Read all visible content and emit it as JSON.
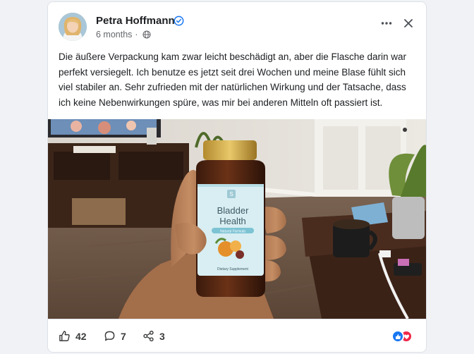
{
  "post": {
    "author": "Petra Hoffmann",
    "time": "6 months",
    "separator": "·",
    "body": "Die äußere Verpackung kam zwar leicht beschädigt an, aber die Flasche darin war perfekt versiegelt. Ich benutze es jetzt seit drei Wochen und meine Blase fühlt sich viel stabiler an. Sehr zufrieden mit der natürlichen Wirkung und der Tatsache, dass ich keine Nebenwirkungen spüre, was mir bei anderen Mitteln oft passiert ist."
  },
  "photo": {
    "bottle_line1": "Bladder",
    "bottle_line2": "Health",
    "bottle_badge": "S",
    "bottle_tagline": "Natural Formula",
    "bottle_footer": "Dietary Supplement"
  },
  "footer": {
    "likes": "42",
    "comments": "7",
    "shares": "3"
  },
  "icons": {
    "verified": "verified-badge-icon",
    "visibility": "globe-icon",
    "more": "more-horizontal-icon",
    "close": "close-icon",
    "like": "thumbs-up-icon",
    "comment": "comment-icon",
    "share": "share-icon"
  },
  "colors": {
    "verified": "#1877f2",
    "like_reaction": "#1877f2",
    "love_reaction": "#f02849"
  }
}
